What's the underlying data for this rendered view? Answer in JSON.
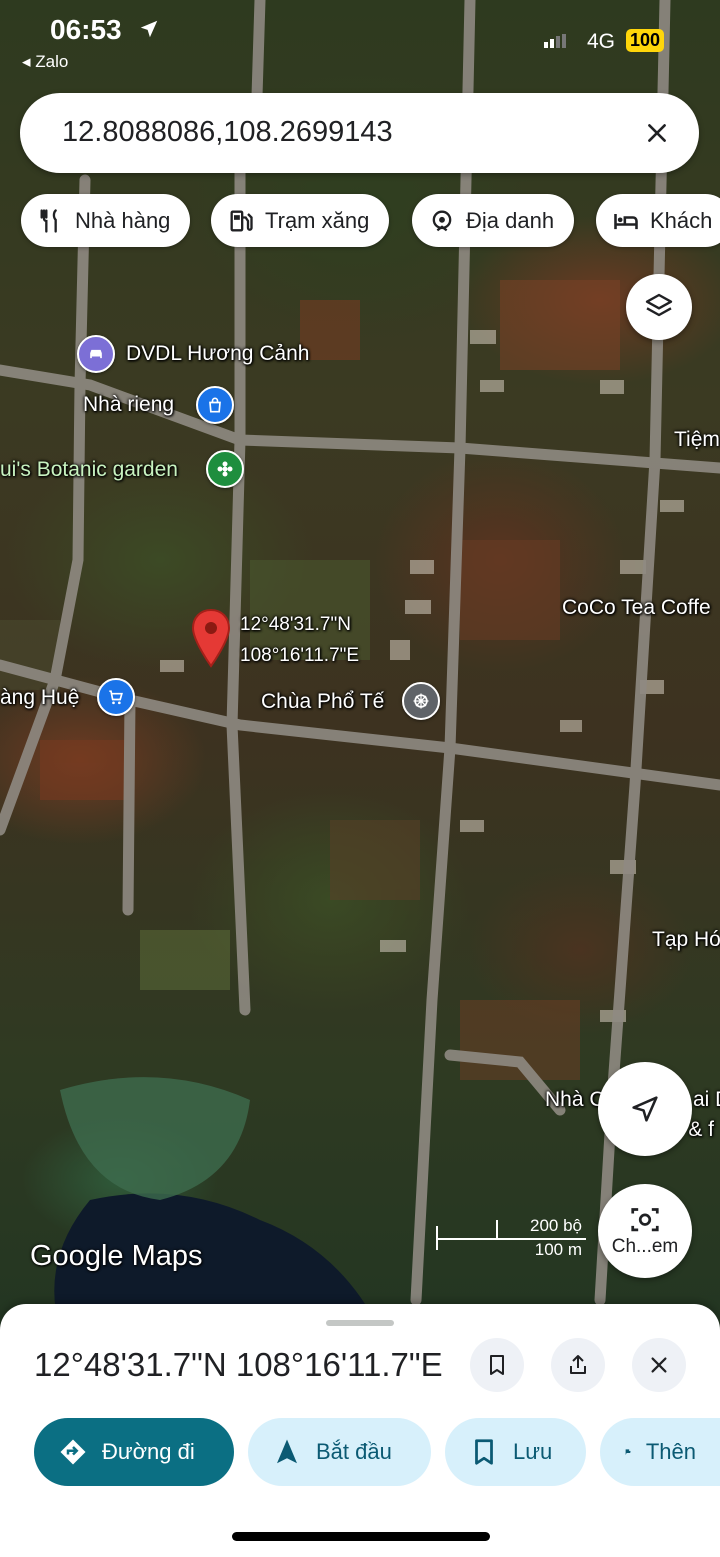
{
  "status_bar": {
    "time": "06:53",
    "back_app": "◂ Zalo",
    "network": "4G",
    "battery": "100"
  },
  "search": {
    "value": "12.8088086,108.2699143"
  },
  "chips": [
    {
      "label": "Nhà hàng",
      "icon": "restaurant-icon"
    },
    {
      "label": "Trạm xăng",
      "icon": "gas-station-icon"
    },
    {
      "label": "Địa danh",
      "icon": "landmark-icon"
    },
    {
      "label": "Khách",
      "icon": "hotel-icon"
    }
  ],
  "map": {
    "pins": [
      {
        "label": "DVDL Hương Cảnh",
        "icon": "car-icon"
      },
      {
        "label": "Nhà rieng",
        "icon": "shopping-bag-icon"
      },
      {
        "label": "ui's Botanic garden",
        "icon": "flower-icon"
      },
      {
        "label": "àng Huệ",
        "icon": "cart-icon"
      },
      {
        "label": "Chùa Phổ Tế",
        "icon": "temple-wheel-icon"
      }
    ],
    "dropped_pin": {
      "lat_label": "12°48'31.7\"N",
      "lng_label": "108°16'11.7\"E"
    },
    "edge_labels": [
      "Tiệm",
      "CoCo Tea Coffe",
      "Tạp Hó",
      "Nhà C",
      "ai D",
      "y & f"
    ],
    "brand": "Google Maps",
    "scale": {
      "imperial": "200 bộ",
      "metric": "100 m"
    },
    "lens_label": "Ch...em"
  },
  "sheet": {
    "title": "12°48'31.7\"N 108°16'11.7\"E",
    "actions": [
      {
        "label": "Đường đi",
        "icon": "directions-icon"
      },
      {
        "label": "Bắt đầu",
        "icon": "navigation-arrow-icon"
      },
      {
        "label": "Lưu",
        "icon": "bookmark-icon"
      },
      {
        "label": "Thên",
        "icon": "flag-icon"
      }
    ]
  },
  "colors": {
    "pin_red": "#e53935",
    "primary_action": "#0b6f83",
    "chip_action": "#d7f0fb",
    "poi_blue": "#1a73e8",
    "poi_green": "#1e8e3e",
    "poi_purple": "#7c6fd6",
    "poi_gray": "#5f6368"
  }
}
